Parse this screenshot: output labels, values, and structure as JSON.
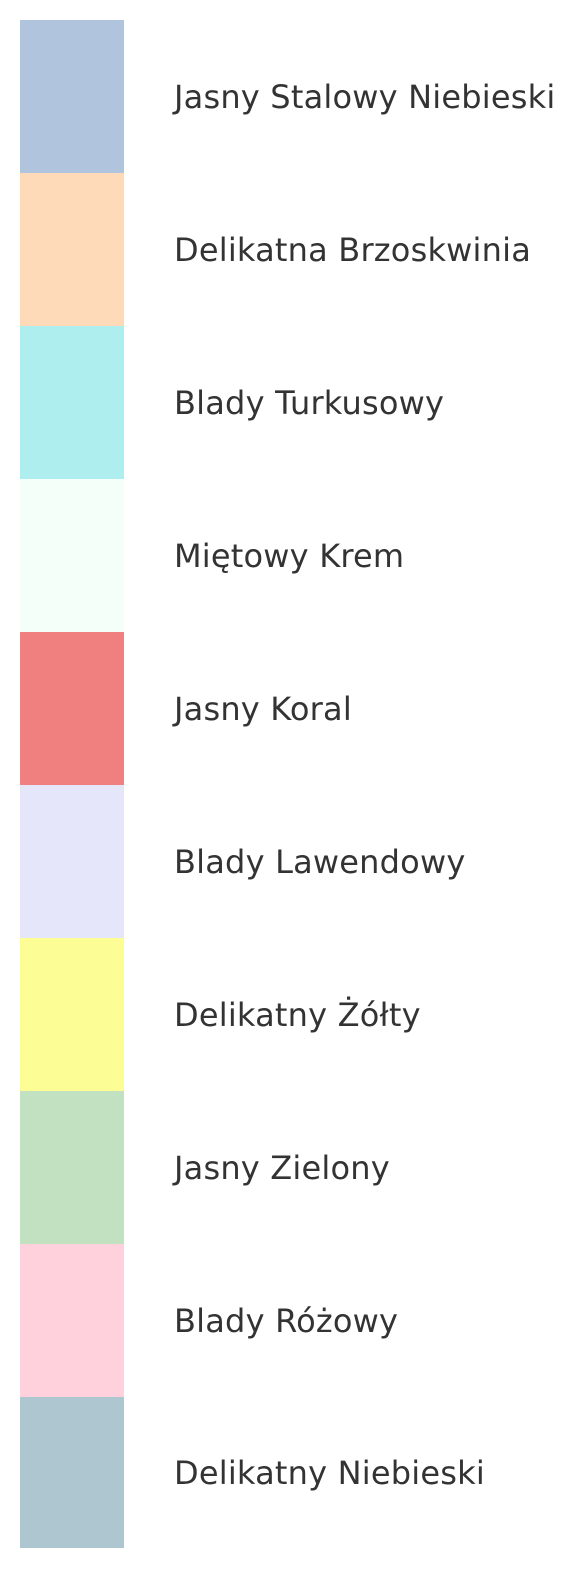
{
  "swatches": [
    {
      "label": "Jasny Stalowy Niebieski",
      "color": "#b0c4de"
    },
    {
      "label": "Delikatna Brzoskwinia",
      "color": "#ffdab9"
    },
    {
      "label": "Blady Turkusowy",
      "color": "#afeeee"
    },
    {
      "label": "Miętowy Krem",
      "color": "#f5fffa"
    },
    {
      "label": "Jasny Koral",
      "color": "#f08080"
    },
    {
      "label": "Blady Lawendowy",
      "color": "#e6e6fa"
    },
    {
      "label": "Delikatny Żółty",
      "color": "#fdfd96"
    },
    {
      "label": "Jasny Zielony",
      "color": "#c1e1c1"
    },
    {
      "label": "Blady Różowy",
      "color": "#ffd1dc"
    },
    {
      "label": "Delikatny Niebieski",
      "color": "#aec6cf"
    }
  ]
}
